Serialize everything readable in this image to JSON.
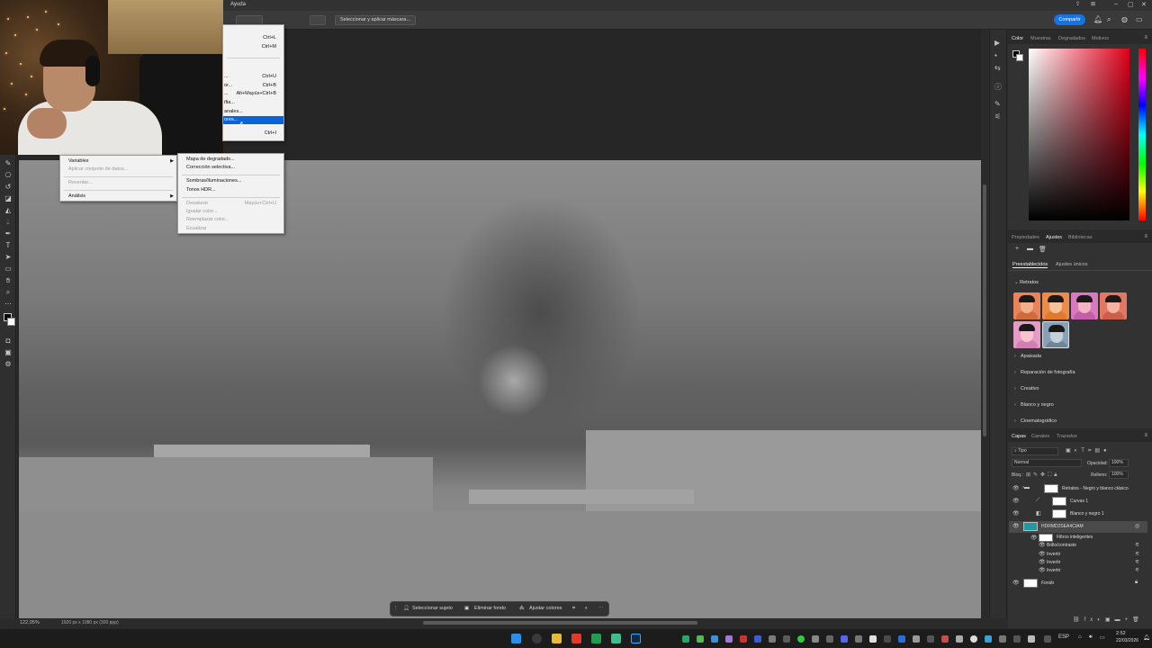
{
  "menubar": {
    "help_label": "Ayuda"
  },
  "options_bar": {
    "select_mask_label": "Seleccionar y aplicar máscara...",
    "share_label": "Compartir"
  },
  "image_menu": {
    "items": [
      {
        "label": "",
        "shortcut": "Ctrl+L"
      },
      {
        "label": "",
        "shortcut": "Ctrl+M"
      },
      {
        "label": "...",
        "shortcut": "Ctrl+U"
      },
      {
        "label": "or...",
        "shortcut": "Ctrl+B"
      },
      {
        "label": "...",
        "shortcut": "Alt+Mayús+Ctrl+B"
      },
      {
        "label": "ífia...",
        "shortcut": ""
      },
      {
        "label": "anales...",
        "shortcut": ""
      },
      {
        "label": "ores...",
        "shortcut": ""
      },
      {
        "label": "",
        "shortcut": "Ctrl+I"
      }
    ]
  },
  "adjust_submenu": {
    "items": [
      {
        "label": "Mapa de degradado..."
      },
      {
        "label": "Corrección selectiva..."
      },
      {
        "label": "Sombras/iluminaciones..."
      },
      {
        "label": "Tonos HDR..."
      },
      {
        "label": "Desaturar",
        "shortcut": "Mayús+Ctrl+U"
      },
      {
        "label": "Igualar color..."
      },
      {
        "label": "Reemplazar color..."
      },
      {
        "label": "Ecualizar"
      }
    ]
  },
  "left_menu": {
    "items": [
      {
        "label": "Variables"
      },
      {
        "label": "Aplicar conjunto de datos..."
      },
      {
        "label": "Reventar..."
      },
      {
        "label": "Análisis"
      }
    ]
  },
  "status": {
    "zoom": "122,05%",
    "doc_size": "1920 px x 1080 px (300 ppp)"
  },
  "contextual_taskbar": {
    "select_subject": "Seleccionar sujeto",
    "remove_bg": "Eliminar fondo",
    "adjust_colors": "Ajustar colores"
  },
  "color_panel": {
    "tabs": [
      "Color",
      "Muestras",
      "Degradados",
      "Motivos"
    ]
  },
  "adjust_panel": {
    "tabs": [
      "Propiedades",
      "Ajustes",
      "Bibliotecas"
    ],
    "subtabs": [
      "Preestablecidos",
      "Ajustes únicos"
    ],
    "section_title": "Retratos",
    "categories": [
      "Apaisada",
      "Reparación de fotografía",
      "Creativo",
      "Blanco y negro",
      "Cinematográfico"
    ]
  },
  "layers_panel": {
    "tabs": [
      "Capas",
      "Canales",
      "Trazados"
    ],
    "filter_label": "Tipo",
    "blend_mode": "Normal",
    "opacity_label": "Opacidad:",
    "opacity_value": "100%",
    "lock_label": "Bloq.:",
    "fill_label": "Relleno:",
    "fill_value": "100%",
    "layers": [
      {
        "name": "Retratos - Negro y blanco clásico"
      },
      {
        "name": "Curvas 1"
      },
      {
        "name": "Blanco y negro 1"
      },
      {
        "name": "HDRMD2SEA4CIAM"
      },
      {
        "name": "Filtros inteligentes"
      },
      {
        "name": "Brillo/contraste"
      },
      {
        "name": "Invertir"
      },
      {
        "name": "Invertir"
      },
      {
        "name": "Invertir"
      },
      {
        "name": "Fondo"
      }
    ]
  },
  "win_taskbar": {
    "lang": "ESP",
    "time": "2:52",
    "date": "22/03/2026"
  },
  "colors": {
    "accent": "#1473e6",
    "menu_highlight": "#0a64d6"
  }
}
